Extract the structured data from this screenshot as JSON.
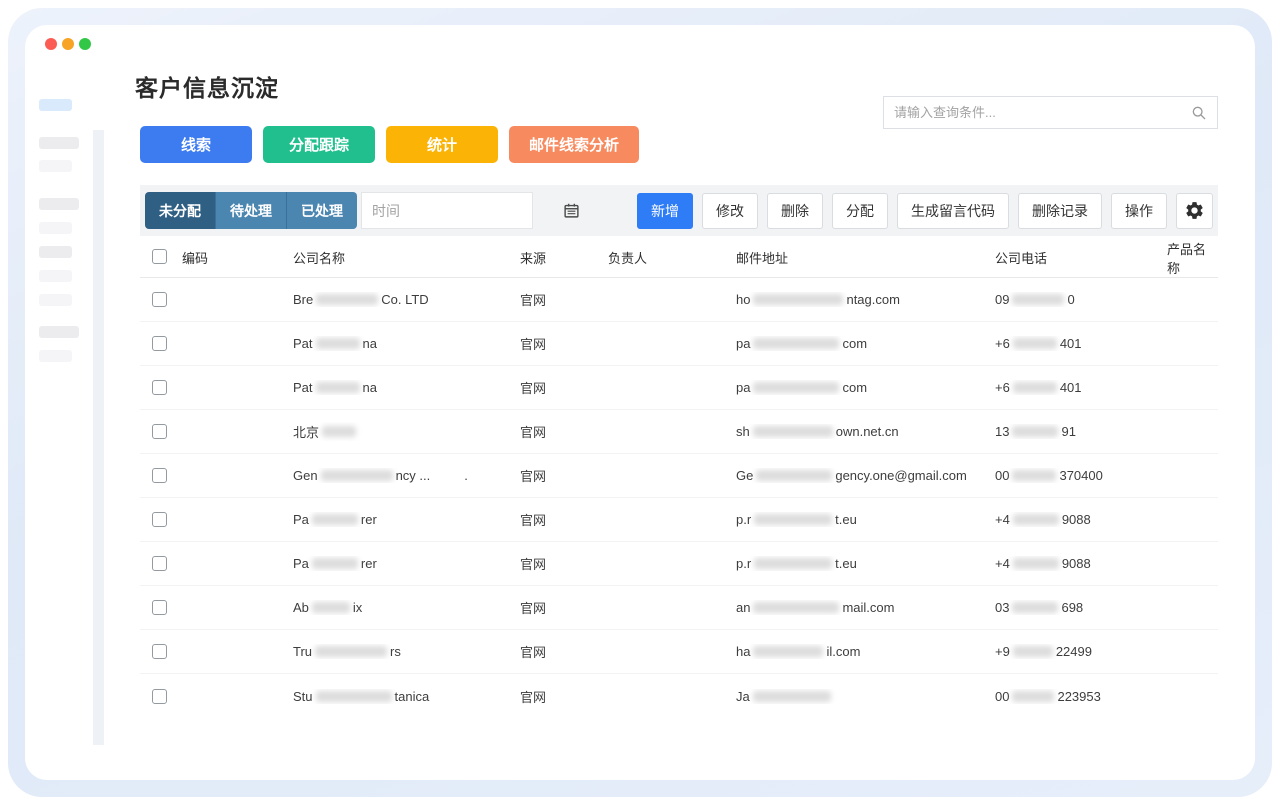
{
  "header": {
    "title": "客户信息沉淀"
  },
  "search": {
    "placeholder": "请输入查询条件...",
    "icon": "search-icon"
  },
  "colors": {
    "leads_blue": "#3d7bf0",
    "assign_green": "#22bf8e",
    "stats_amber": "#fbb306",
    "email_orange": "#f78a5e",
    "primary_blue": "#2e7cf6",
    "tab_active": "#2f5f83",
    "tab_inactive": "#4a86b0"
  },
  "nav_buttons": [
    {
      "name": "leads-button",
      "label": "线索",
      "color": "#3d7bf0"
    },
    {
      "name": "assign-track-button",
      "label": "分配跟踪",
      "color": "#22bf8e"
    },
    {
      "name": "stats-button",
      "label": "统计",
      "color": "#fbb306"
    },
    {
      "name": "email-lead-analysis-button",
      "label": "邮件线索分析",
      "color": "#f78a5e"
    }
  ],
  "toolbar": {
    "tabs": [
      {
        "name": "tab-unassigned",
        "label": "未分配",
        "active": true
      },
      {
        "name": "tab-pending",
        "label": "待处理",
        "active": false
      },
      {
        "name": "tab-processed",
        "label": "已处理",
        "active": false
      }
    ],
    "date_placeholder": "时间",
    "calendar_icon": "calendar-icon",
    "actions": [
      {
        "name": "add-button",
        "label": "新增",
        "primary": true
      },
      {
        "name": "edit-button",
        "label": "修改",
        "primary": false
      },
      {
        "name": "delete-button",
        "label": "删除",
        "primary": false
      },
      {
        "name": "assign-button",
        "label": "分配",
        "primary": false
      },
      {
        "name": "generate-code-button",
        "label": "生成留言代码",
        "primary": false
      },
      {
        "name": "delete-record-button",
        "label": "删除记录",
        "primary": false
      },
      {
        "name": "operate-button",
        "label": "操作",
        "primary": false
      }
    ],
    "gear_icon": "gear-icon"
  },
  "table": {
    "columns": [
      "编码",
      "公司名称",
      "来源",
      "负责人",
      "邮件地址",
      "公司电话",
      "产品名称"
    ],
    "rows": [
      {
        "code": "",
        "company": [
          {
            "t": "Bre"
          },
          {
            "b": 62
          },
          {
            "t": " Co. LTD"
          }
        ],
        "source": "官网",
        "owner": "",
        "email": [
          {
            "t": "ho"
          },
          {
            "b": 90
          },
          {
            "t": "ntag.com"
          }
        ],
        "phone": [
          {
            "t": "09"
          },
          {
            "b": 52
          },
          {
            "t": "0"
          }
        ],
        "product": ""
      },
      {
        "code": "",
        "company": [
          {
            "t": "Pat"
          },
          {
            "b": 44
          },
          {
            "t": "na"
          }
        ],
        "source": "官网",
        "owner": "",
        "email": [
          {
            "t": "pa"
          },
          {
            "b": 86
          },
          {
            "t": "com"
          }
        ],
        "phone": [
          {
            "t": "+6"
          },
          {
            "b": 44
          },
          {
            "t": "401"
          }
        ],
        "product": ""
      },
      {
        "code": "",
        "company": [
          {
            "t": "Pat"
          },
          {
            "b": 44
          },
          {
            "t": "na"
          }
        ],
        "source": "官网",
        "owner": "",
        "email": [
          {
            "t": "pa"
          },
          {
            "b": 86
          },
          {
            "t": "com"
          }
        ],
        "phone": [
          {
            "t": "+6"
          },
          {
            "b": 44
          },
          {
            "t": "401"
          }
        ],
        "product": ""
      },
      {
        "code": "",
        "company": [
          {
            "t": "北京"
          },
          {
            "b": 34
          }
        ],
        "source": "官网",
        "owner": "",
        "email": [
          {
            "t": "sh"
          },
          {
            "b": 80
          },
          {
            "t": "own.net.cn"
          }
        ],
        "phone": [
          {
            "t": "13"
          },
          {
            "b": 46
          },
          {
            "t": "91"
          }
        ],
        "product": ""
      },
      {
        "code": "",
        "company": [
          {
            "t": "Gen"
          },
          {
            "b": 72
          },
          {
            "t": "ncy ..."
          },
          {
            "gap": 34
          },
          {
            "t": "."
          }
        ],
        "source": "官网",
        "owner": "",
        "email": [
          {
            "t": "Ge"
          },
          {
            "b": 76
          },
          {
            "t": "gency.one@gmail.com"
          }
        ],
        "phone": [
          {
            "t": "00"
          },
          {
            "b": 44
          },
          {
            "t": "370400"
          }
        ],
        "product": ""
      },
      {
        "code": "",
        "company": [
          {
            "t": "Pa"
          },
          {
            "b": 46
          },
          {
            "t": "rer"
          }
        ],
        "source": "官网",
        "owner": "",
        "email": [
          {
            "t": "p.r"
          },
          {
            "b": 78
          },
          {
            "t": "t.eu"
          }
        ],
        "phone": [
          {
            "t": "+4"
          },
          {
            "b": 46
          },
          {
            "t": "9088"
          }
        ],
        "product": ""
      },
      {
        "code": "",
        "company": [
          {
            "t": "Pa"
          },
          {
            "b": 46
          },
          {
            "t": "rer"
          }
        ],
        "source": "官网",
        "owner": "",
        "email": [
          {
            "t": "p.r"
          },
          {
            "b": 78
          },
          {
            "t": "t.eu"
          }
        ],
        "phone": [
          {
            "t": "+4"
          },
          {
            "b": 46
          },
          {
            "t": "9088"
          }
        ],
        "product": ""
      },
      {
        "code": "",
        "company": [
          {
            "t": "Ab"
          },
          {
            "b": 38
          },
          {
            "t": "ix"
          }
        ],
        "source": "官网",
        "owner": "",
        "email": [
          {
            "t": "an"
          },
          {
            "b": 86
          },
          {
            "t": "mail.com"
          }
        ],
        "phone": [
          {
            "t": "03"
          },
          {
            "b": 46
          },
          {
            "t": "698"
          }
        ],
        "product": ""
      },
      {
        "code": "",
        "company": [
          {
            "t": "Tru"
          },
          {
            "b": 72
          },
          {
            "t": "rs"
          }
        ],
        "source": "官网",
        "owner": "",
        "email": [
          {
            "t": "ha"
          },
          {
            "b": 70
          },
          {
            "t": "il.com"
          }
        ],
        "phone": [
          {
            "t": "+9"
          },
          {
            "b": 40
          },
          {
            "t": "22499"
          }
        ],
        "product": ""
      },
      {
        "code": "",
        "company": [
          {
            "t": "Stu"
          },
          {
            "b": 76
          },
          {
            "t": "tanica"
          }
        ],
        "source": "官网",
        "owner": "",
        "email": [
          {
            "t": "Ja"
          },
          {
            "b": 78
          }
        ],
        "phone": [
          {
            "t": "00"
          },
          {
            "b": 42
          },
          {
            "t": "223953"
          }
        ],
        "product": ""
      }
    ]
  }
}
